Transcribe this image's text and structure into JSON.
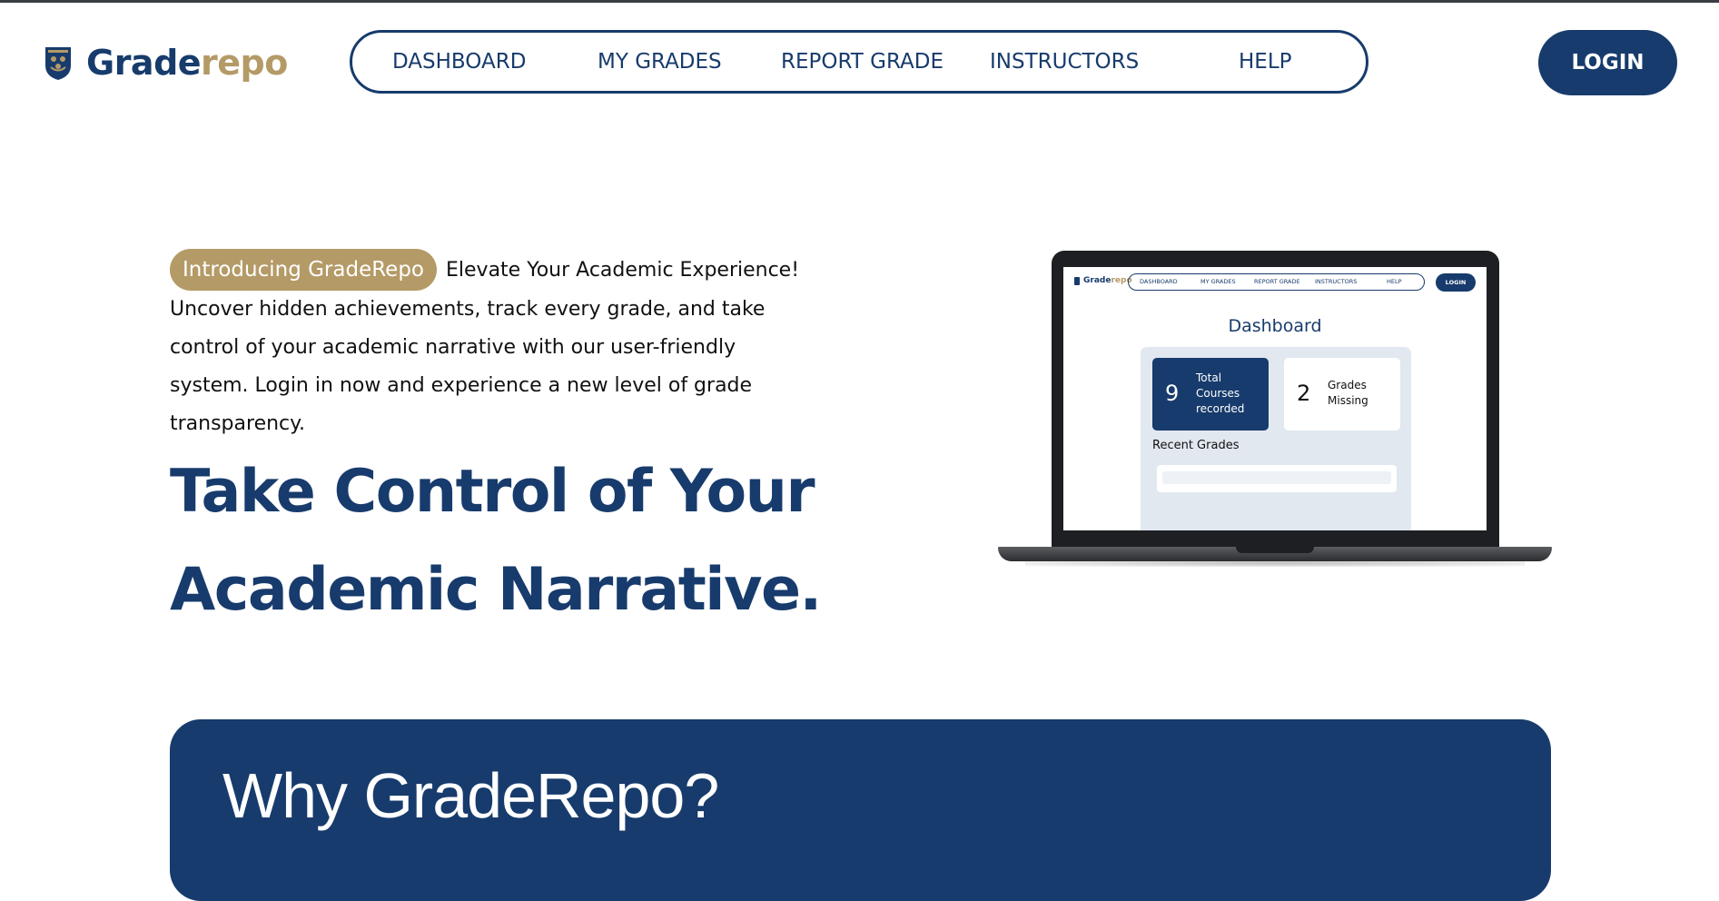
{
  "header": {
    "logo": {
      "part1": "Grade",
      "part2": "repo",
      "icon": "crest-icon"
    },
    "nav": [
      "DASHBOARD",
      "MY GRADES",
      "REPORT GRADE",
      "INSTRUCTORS",
      "HELP"
    ],
    "login_label": "LOGIN"
  },
  "hero": {
    "badge": "Introducing GradeRepo",
    "intro_text": "Elevate Your Academic Experience! Uncover hidden achievements, track every grade, and take control of your academic narrative with our user-friendly system. Login in now and experience a new level of grade transparency.",
    "headline_line1": "Take Control of Your",
    "headline_line2": "Academic Narrative."
  },
  "preview": {
    "logo": {
      "part1": "Grade",
      "part2": "repo"
    },
    "nav": [
      "DASHBOARD",
      "MY GRADES",
      "REPORT GRADE",
      "INSTRUCTORS",
      "HELP"
    ],
    "login_label": "LOGIN",
    "title": "Dashboard",
    "cards": [
      {
        "number": "9",
        "label": "Total Courses recorded"
      },
      {
        "number": "2",
        "label": "Grades Missing"
      }
    ],
    "recent_label": "Recent Grades"
  },
  "why": {
    "title": "Why GradeRepo?"
  },
  "colors": {
    "primary": "#173b6c",
    "accent": "#b49a66",
    "panel": "#e2e8f0"
  }
}
